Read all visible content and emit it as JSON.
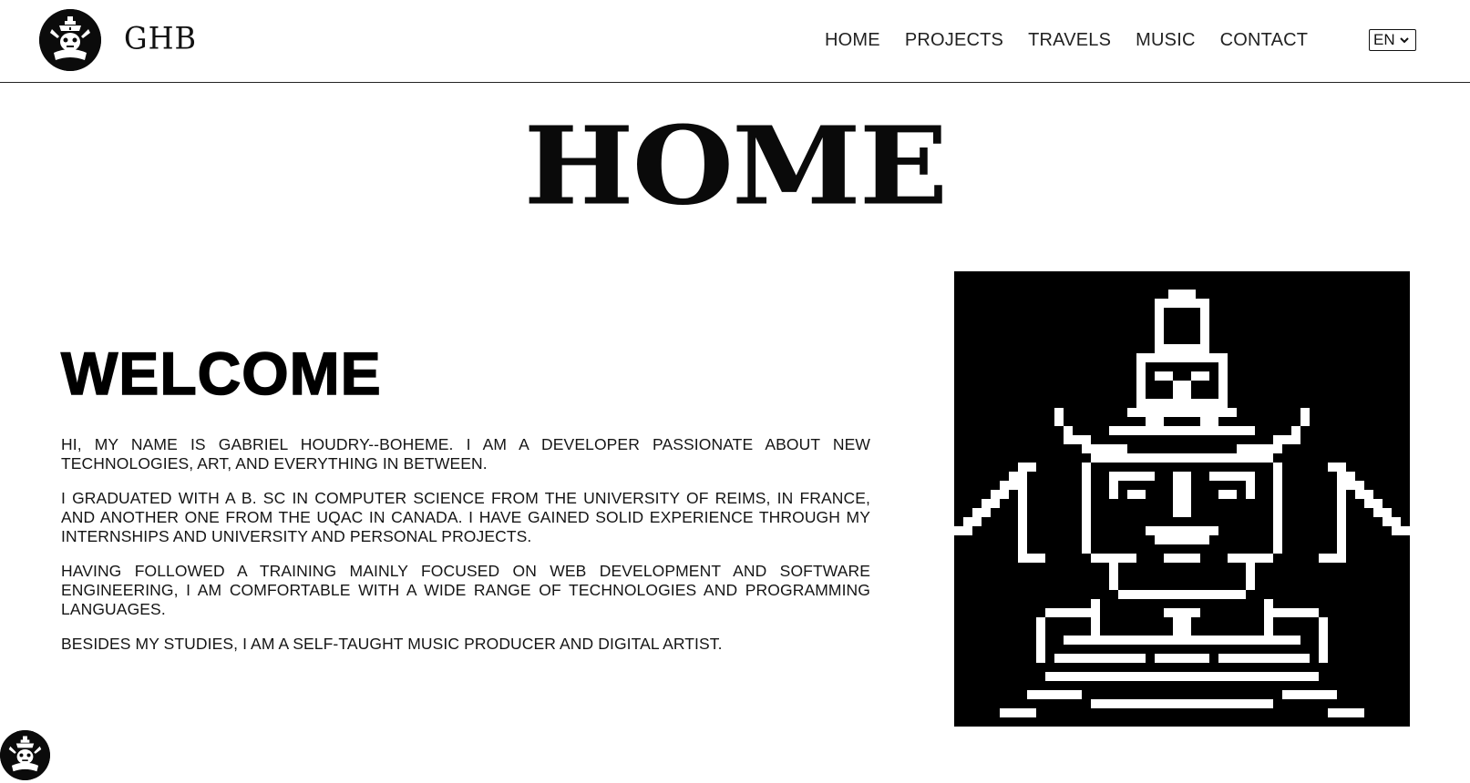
{
  "brand": {
    "logo_icon": "ornate-mask-emblem-icon",
    "wordmark": "GHB"
  },
  "nav": {
    "items": [
      {
        "label": "HOME"
      },
      {
        "label": "PROJECTS"
      },
      {
        "label": "TRAVELS"
      },
      {
        "label": "MUSIC"
      },
      {
        "label": "CONTACT"
      }
    ]
  },
  "language": {
    "selected": "EN",
    "icon": "chevron-down-icon"
  },
  "page": {
    "title": "HOME"
  },
  "welcome": {
    "heading": "WELCOME",
    "paragraphs": [
      "HI, MY NAME IS GABRIEL HOUDRY--BOHEME. I AM A DEVELOPER PASSIONATE ABOUT NEW TECHNOLOGIES, ART, AND EVERYTHING IN BETWEEN.",
      "I GRADUATED WITH A B. SC IN COMPUTER SCIENCE FROM THE UNIVERSITY OF REIMS, IN FRANCE, AND ANOTHER ONE FROM THE UQAC IN CANADA. I HAVE GAINED SOLID EXPERIENCE THROUGH MY INTERNSHIPS AND UNIVERSITY AND PERSONAL PROJECTS.",
      "HAVING FOLLOWED A TRAINING MAINLY FOCUSED ON WEB DEVELOPMENT AND SOFTWARE ENGINEERING, I AM COMFORTABLE WITH A WIDE RANGE OF TECHNOLOGIES AND PROGRAMMING LANGUAGES.",
      "BESIDES MY STUDIES, I AM A SELF-TAUGHT MUSIC PRODUCER AND DIGITAL ARTIST."
    ]
  },
  "artwork": {
    "icon": "pixel-art-mask-figure-icon",
    "colors": {
      "background": "#000000",
      "foreground": "#ffffff"
    }
  },
  "corner_badge": {
    "icon": "ornate-mask-emblem-icon"
  }
}
